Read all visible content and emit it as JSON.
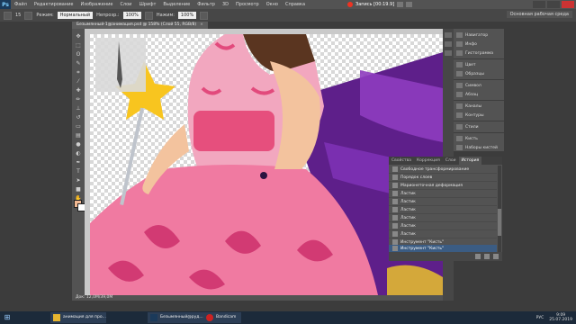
{
  "app": {
    "logo": "Ps",
    "accent": "#3b5c83"
  },
  "menu": [
    "Файл",
    "Редактирование",
    "Изображение",
    "Слои",
    "Шрифт",
    "Выделение",
    "Фильтр",
    "3D",
    "Просмотр",
    "Окно",
    "Справка"
  ],
  "recording": {
    "label": "Запись [00:19.9]"
  },
  "options": {
    "mode_label": "Режим:",
    "mode_value": "Нормальный",
    "opacity_label": "Непрозр.:",
    "opacity_value": "100%",
    "flow_label": "Нажим:",
    "flow_value": "100%",
    "brush_size": "15"
  },
  "workspace_label": "Основная рабочая среда",
  "document_tab": {
    "title": "Безымянный-1@анимация.psd @ 158% (Слой 55, RGB/8)",
    "close": "×"
  },
  "status": "Док: 12,0M/39,0M",
  "panels": [
    "Навигатор",
    "Инфо",
    "Гистограмма",
    "Цвет",
    "Образцы",
    "Символ",
    "Абзац",
    "Каналы",
    "Контуры",
    "Стили",
    "Кисть",
    "Наборы кистей"
  ],
  "history": {
    "tabs": [
      "Свойства",
      "Коррекция",
      "Слои",
      "История"
    ],
    "active_tab": "История",
    "items": [
      "Свободное трансформирование",
      "Порядок слоев",
      "Марионеточная деформация",
      "Ластик",
      "Ластик",
      "Ластик",
      "Ластик",
      "Ластик",
      "Ластик",
      "Инструмент \"Кисть\"",
      "Инструмент \"Кисть\""
    ],
    "selected_index": 10
  },
  "taskbar": {
    "buttons": [
      "анимация для про...",
      "Безымянный@руд...",
      "Bandicam"
    ],
    "tray_lang": "РУС",
    "time": "9:09",
    "date": "25.07.2019"
  }
}
